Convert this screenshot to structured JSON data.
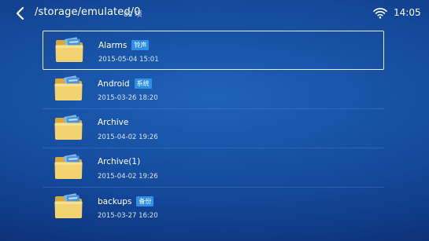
{
  "header": {
    "path": "/storage/emulated/0",
    "count": "82 项",
    "time": "14:05",
    "back_icon": "chevron-left-icon",
    "wifi_icon": "wifi-icon"
  },
  "colors": {
    "background": "#14499a",
    "badge": "#2f8ee6",
    "folder": "#f1cf6a"
  },
  "files": [
    {
      "name": "Alarms",
      "tag": "铃声",
      "date": "2015-05-04 15:01",
      "selected": true
    },
    {
      "name": "Android",
      "tag": "系统",
      "date": "2015-03-26 18:20",
      "selected": false
    },
    {
      "name": "Archive",
      "tag": "",
      "date": "2015-04-02 19:26",
      "selected": false
    },
    {
      "name": "Archive(1)",
      "tag": "",
      "date": "2015-04-02 19:26",
      "selected": false
    },
    {
      "name": "backups",
      "tag": "备份",
      "date": "2015-03-27 16:20",
      "selected": false
    }
  ]
}
